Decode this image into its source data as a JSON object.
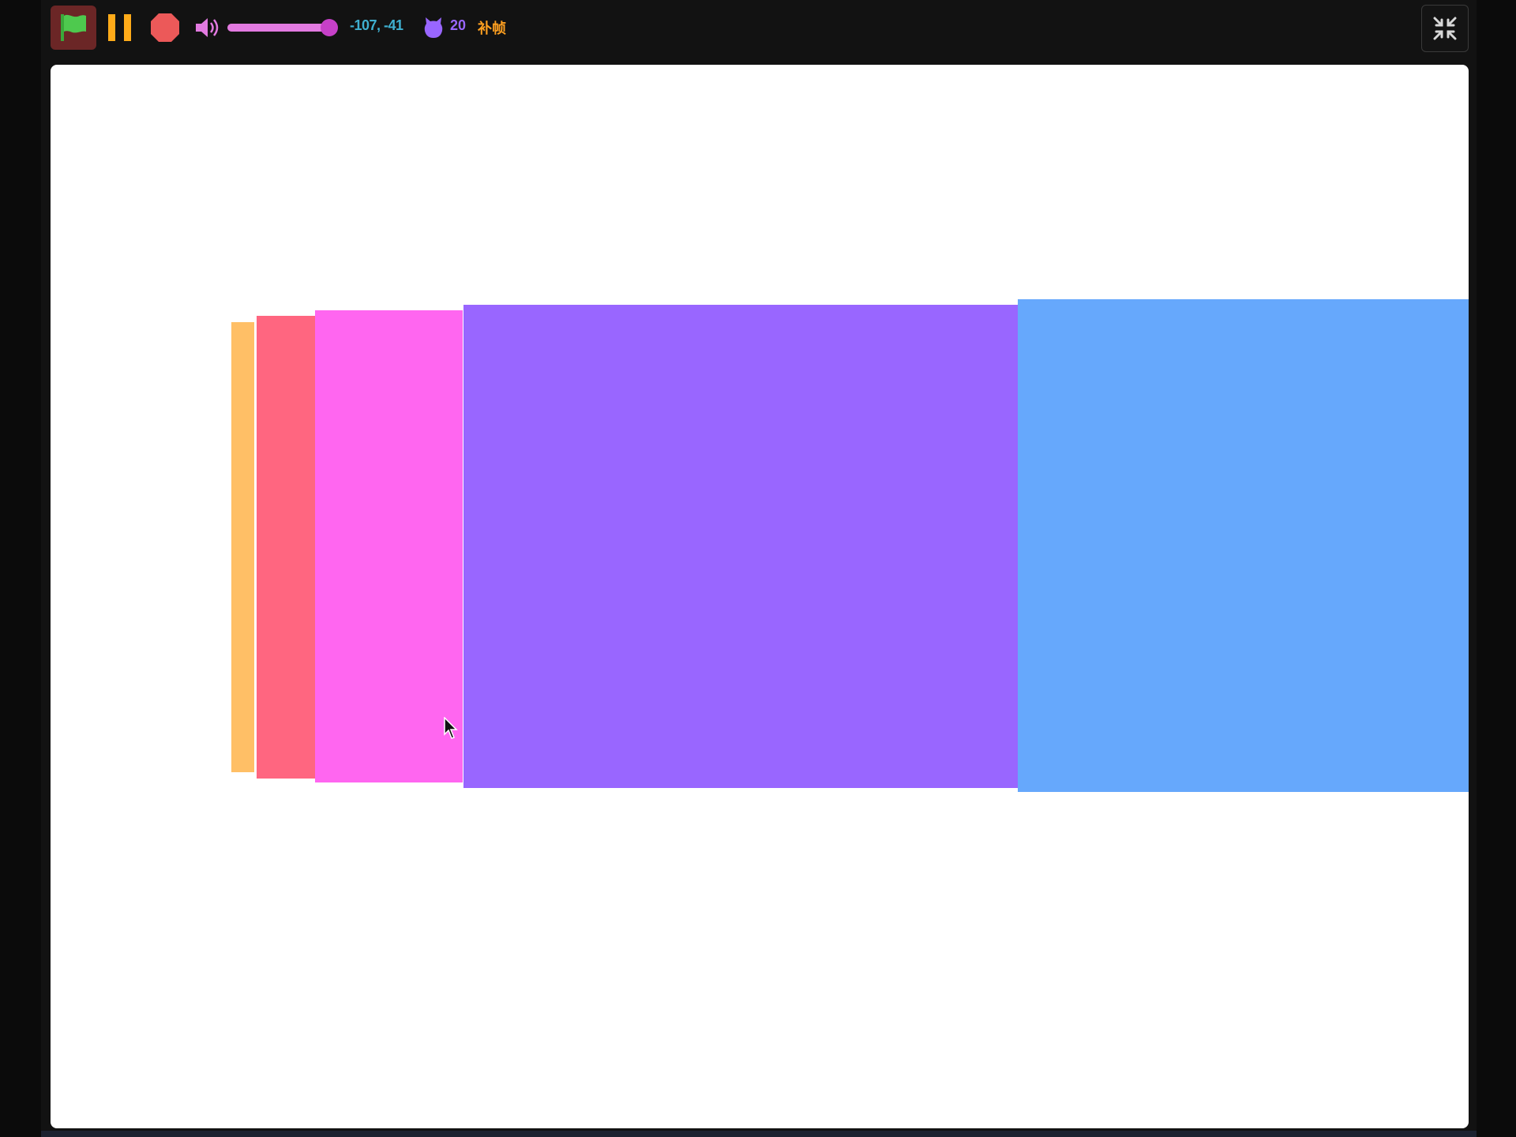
{
  "toolbar": {
    "green_flag": {
      "icon": "green-flag-icon",
      "color": "#4ec94e"
    },
    "pause": {
      "icon": "pause-icon",
      "color": "#ffab19"
    },
    "stop": {
      "icon": "stop-icon",
      "color": "#ec5959"
    },
    "volume": {
      "icon": "speaker-icon",
      "level": 0.92
    },
    "mouse_coords": "-107, -41",
    "sprite_count_icon": "cat-icon",
    "sprite_count": "20",
    "interpolation_label": "补帧",
    "exit_fullscreen": {
      "icon": "exit-fullscreen-icon"
    }
  },
  "stage": {
    "background": "#ffffff",
    "bars": [
      {
        "name": "orange-bar",
        "color": "#ffbf66"
      },
      {
        "name": "red-bar",
        "color": "#ff6680"
      },
      {
        "name": "pink-bar",
        "color": "#ff66f0"
      },
      {
        "name": "purple-bar",
        "color": "#9966ff"
      },
      {
        "name": "blue-bar",
        "color": "#66a8fc"
      }
    ]
  }
}
